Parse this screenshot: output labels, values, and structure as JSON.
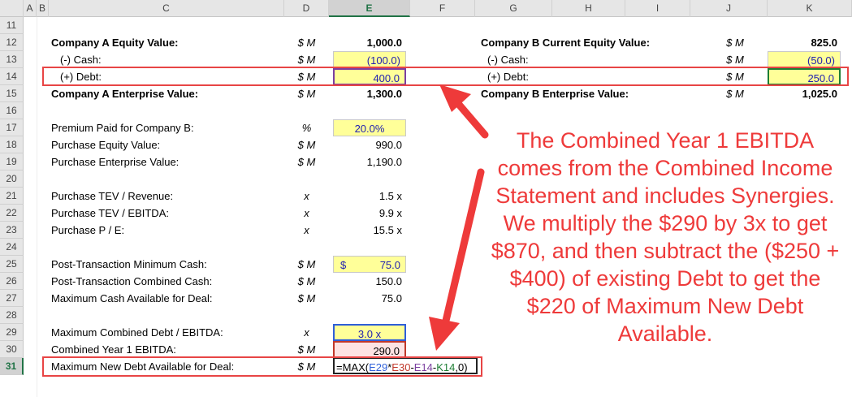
{
  "columns": [
    "A",
    "B",
    "C",
    "D",
    "E",
    "F",
    "G",
    "H",
    "I",
    "J",
    "K"
  ],
  "rows": [
    "11",
    "12",
    "13",
    "14",
    "15",
    "16",
    "17",
    "18",
    "19",
    "20",
    "21",
    "22",
    "23",
    "24",
    "25",
    "26",
    "27",
    "28",
    "29",
    "30",
    "31"
  ],
  "selected_column": "E",
  "selected_row": "31",
  "company_a": {
    "equity_label": "Company A Equity Value:",
    "equity_unit": "$ M",
    "equity_value": "1,000.0",
    "cash_label": "(-) Cash:",
    "cash_unit": "$ M",
    "cash_value": "(100.0)",
    "debt_label": "(+) Debt:",
    "debt_unit": "$ M",
    "debt_value": "400.0",
    "ev_label": "Company A Enterprise Value:",
    "ev_unit": "$ M",
    "ev_value": "1,300.0"
  },
  "company_b": {
    "equity_label": "Company B Current Equity Value:",
    "equity_unit": "$ M",
    "equity_value": "825.0",
    "cash_label": "(-) Cash:",
    "cash_unit": "$ M",
    "cash_value": "(50.0)",
    "debt_label": "(+) Debt:",
    "debt_unit": "$ M",
    "debt_value": "250.0",
    "ev_label": "Company B Enterprise Value:",
    "ev_unit": "$ M",
    "ev_value": "1,025.0"
  },
  "deal": {
    "premium_label": "Premium Paid for Company B:",
    "premium_unit": "%",
    "premium_value": "20.0%",
    "pev_label": "Purchase Equity Value:",
    "pev_unit": "$ M",
    "pev_value": "990.0",
    "pent_label": "Purchase Enterprise Value:",
    "pent_unit": "$ M",
    "pent_value": "1,190.0",
    "tev_rev_label": "Purchase TEV / Revenue:",
    "tev_rev_unit": "x",
    "tev_rev_value": "1.5 x",
    "tev_ebitda_label": "Purchase TEV / EBITDA:",
    "tev_ebitda_unit": "x",
    "tev_ebitda_value": "9.9 x",
    "pe_label": "Purchase P / E:",
    "pe_unit": "x",
    "pe_value": "15.5 x",
    "min_cash_label": "Post-Transaction Minimum Cash:",
    "min_cash_unit": "$ M",
    "min_cash_currency": "$",
    "min_cash_value": "75.0",
    "comb_cash_label": "Post-Transaction Combined Cash:",
    "comb_cash_unit": "$ M",
    "comb_cash_value": "150.0",
    "max_cash_label": "Maximum Cash Available for Deal:",
    "max_cash_unit": "$ M",
    "max_cash_value": "75.0",
    "max_debt_ebitda_label": "Maximum Combined Debt / EBITDA:",
    "max_debt_ebitda_unit": "x",
    "max_debt_ebitda_value": "3.0 x",
    "comb_ebitda_label": "Combined Year 1 EBITDA:",
    "comb_ebitda_unit": "$ M",
    "comb_ebitda_value": "290.0",
    "max_new_debt_label": "Maximum New Debt Available for Deal:",
    "max_new_debt_unit": "$ M"
  },
  "formula": {
    "prefix": "=MAX(",
    "ref1": "E29",
    "op1": "*",
    "ref2": "E30",
    "op2": "-",
    "ref3": "E14",
    "op3": "-",
    "ref4": "K14",
    "suffix": ",0)"
  },
  "annotation": "The Combined Year 1 EBITDA comes from the Combined Income Statement and includes Synergies. We multiply the $290 by 3x to get $870, and then subtract the ($250 + $400) of existing Debt to get the $220 of Maximum New Debt Available.",
  "colors": {
    "accent_red": "#ee3a3a",
    "input_yellow": "#ffff99",
    "input_blue": "#1f1fb0",
    "excel_green": "#217346"
  }
}
